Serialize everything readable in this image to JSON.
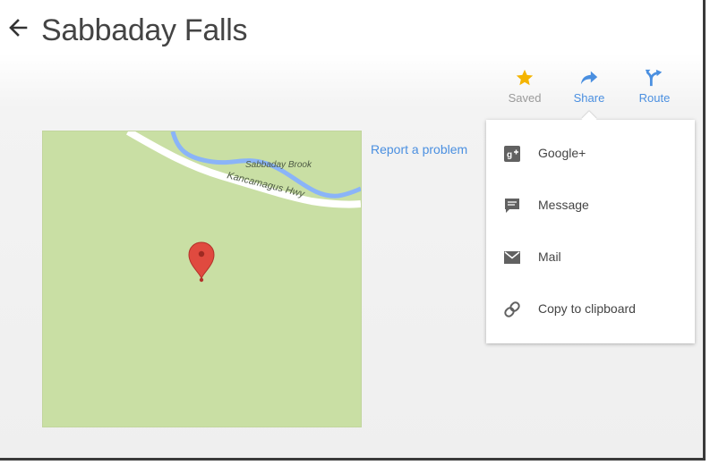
{
  "header": {
    "title": "Sabbaday Falls"
  },
  "actions": [
    {
      "label": "Saved",
      "icon": "star-icon",
      "color": "#f4b400"
    },
    {
      "label": "Share",
      "icon": "share-arrow-icon",
      "color": "#4a8fe0"
    },
    {
      "label": "Route",
      "icon": "route-icon",
      "color": "#4a8fe0"
    }
  ],
  "map": {
    "water_label": "Sabbaday Brook",
    "road_label": "Kancamagus Hwy",
    "marker_icon": "map-pin-icon",
    "colors": {
      "land": "#c9dfa4",
      "water": "#8ab4f8",
      "road": "#ffffff",
      "pin": "#e04a3f"
    }
  },
  "report_link": "Report a problem",
  "share_menu": {
    "items": [
      {
        "label": "Google+",
        "icon": "google-plus-icon"
      },
      {
        "label": "Message",
        "icon": "message-icon"
      },
      {
        "label": "Mail",
        "icon": "mail-icon"
      },
      {
        "label": "Copy to clipboard",
        "icon": "link-icon"
      }
    ]
  }
}
